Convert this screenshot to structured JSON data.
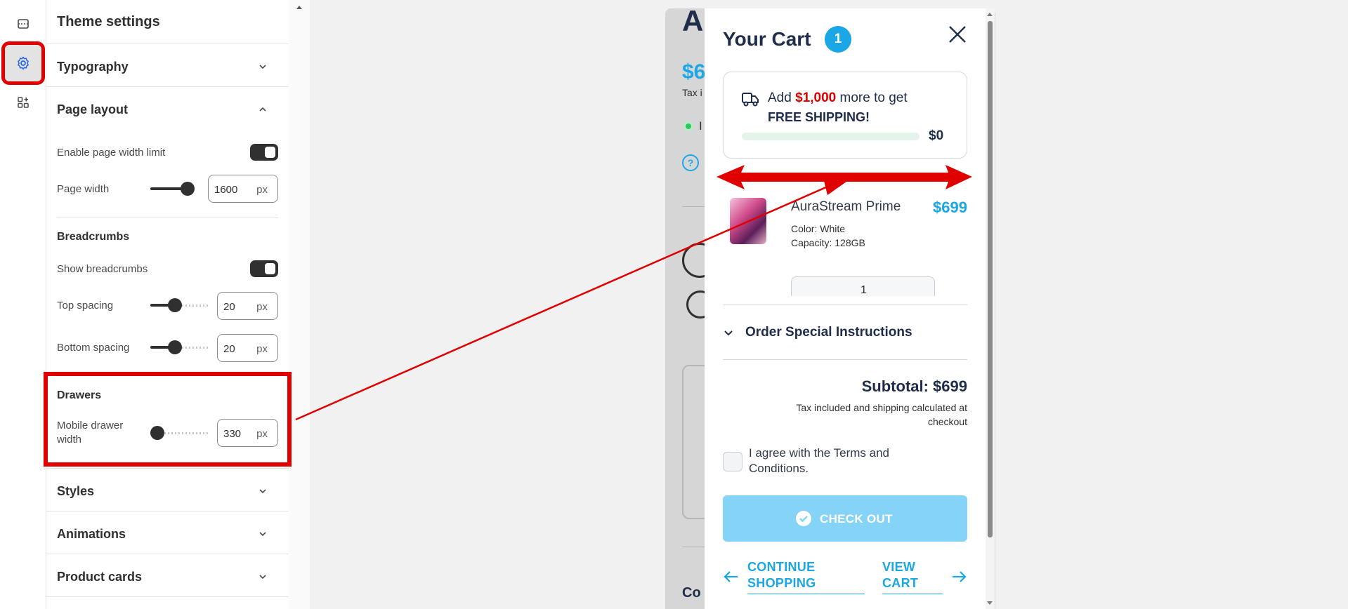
{
  "sidebar_rail": {
    "items": [
      {
        "name": "sections-icon"
      },
      {
        "name": "theme-settings-icon",
        "active": true
      },
      {
        "name": "apps-icon"
      }
    ]
  },
  "panel": {
    "title": "Theme settings",
    "sections": {
      "typography": "Typography",
      "page_layout": "Page layout",
      "styles": "Styles",
      "animations": "Animations",
      "product_cards": "Product cards"
    },
    "page_layout": {
      "enable_width_limit_label": "Enable page width limit",
      "enable_width_limit": true,
      "page_width_label": "Page width",
      "page_width_value": "1600",
      "page_width_unit": "px",
      "breadcrumbs_heading": "Breadcrumbs",
      "show_breadcrumbs_label": "Show breadcrumbs",
      "show_breadcrumbs": true,
      "top_spacing_label": "Top spacing",
      "top_spacing_value": "20",
      "top_spacing_unit": "px",
      "bottom_spacing_label": "Bottom spacing",
      "bottom_spacing_value": "20",
      "bottom_spacing_unit": "px",
      "drawers_heading": "Drawers",
      "mobile_drawer_label": "Mobile drawer width",
      "mobile_drawer_value": "330",
      "mobile_drawer_unit": "px"
    }
  },
  "preview": {
    "partial_heading": "A",
    "partial_price": "$6",
    "partial_tax": "Tax i",
    "partial_stock": "I",
    "partial_footer": "Co"
  },
  "cart": {
    "title": "Your Cart",
    "count": "1",
    "shipping": {
      "prefix": "Add",
      "amount": "$1,000",
      "suffix": "more to get",
      "line2": "FREE SHIPPING!",
      "current": "$0",
      "progress": 0
    },
    "item": {
      "name": "AuraStream Prime",
      "price": "$699",
      "color": "Color: White",
      "capacity": "Capacity: 128GB",
      "qty": "1"
    },
    "instructions_label": "Order Special Instructions",
    "subtotal": "Subtotal: $699",
    "tax_note_1": "Tax included and shipping calculated at",
    "tax_note_2": "checkout",
    "terms_1": "I agree with the Terms and",
    "terms_2": "Conditions.",
    "checkout_label": "CHECK OUT",
    "continue_1": "CONTINUE",
    "continue_2": "SHOPPING",
    "view_1": "VIEW",
    "view_2": "CART"
  },
  "colors": {
    "highlight": "#e00000",
    "cart_accent": "#1ba6e6",
    "checkout_disabled": "#85d3f7",
    "shipping_amount": "#e00000"
  }
}
